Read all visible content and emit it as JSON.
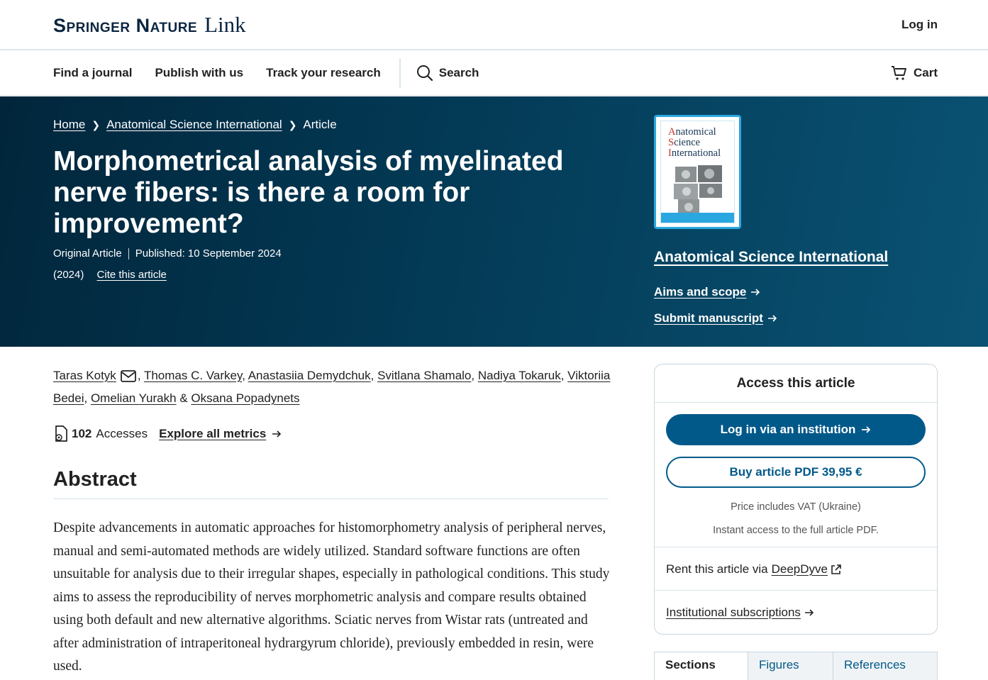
{
  "header": {
    "logo_main": "Springer Nature",
    "logo_link": "Link",
    "login": "Log in"
  },
  "nav": {
    "items": [
      "Find a journal",
      "Publish with us",
      "Track your research"
    ],
    "search": "Search",
    "cart": "Cart"
  },
  "hero": {
    "breadcrumb": [
      "Home",
      "Anatomical Science International",
      "Article"
    ],
    "title": "Morphometrical analysis of myelinated nerve fibers: is there a room for improvement?",
    "article_type": "Original Article",
    "published": "Published: 10 September 2024",
    "year": "(2024)",
    "cite": "Cite this article"
  },
  "journal": {
    "cover_title_lines": [
      [
        "A",
        "natomical"
      ],
      [
        "S",
        "cience"
      ],
      [
        "I",
        "nternational"
      ]
    ],
    "name": "Anatomical Science International",
    "aims": "Aims and scope",
    "submit": "Submit manuscript"
  },
  "authors": [
    "Taras Kotyk",
    "Thomas C. Varkey",
    "Anastasiia Demydchuk",
    "Svitlana Shamalo",
    "Nadiya Tokaruk",
    "Viktoriia Bedei",
    "Omelian Yurakh",
    "Oksana Popadynets"
  ],
  "metrics": {
    "count": "102",
    "label": "Accesses",
    "explore": "Explore all metrics"
  },
  "abstract": {
    "heading": "Abstract",
    "text": "Despite advancements in automatic approaches for histomorphometry analysis of peripheral nerves, manual and semi-automated methods are widely utilized. Standard software functions are often unsuitable for analysis due to their irregular shapes, especially in pathological conditions. This study aims to assess the reproducibility of nerves morphometric analysis and compare results obtained using both default and new alternative algorithms. Sciatic nerves from Wistar rats (untreated and after administration of intraperitoneal hydrargyrum chloride), previously embedded in resin, were used."
  },
  "access": {
    "title": "Access this article",
    "login_institution": "Log in via an institution",
    "buy": "Buy article PDF 39,95 €",
    "vat": "Price includes VAT (Ukraine)",
    "instant": "Instant access to the full article PDF.",
    "rent_prefix": "Rent this article via",
    "rent_link": "DeepDyve",
    "subscriptions": "Institutional subscriptions"
  },
  "tabs": [
    "Sections",
    "Figures",
    "References"
  ],
  "colors": {
    "brand_dark": "#01263b",
    "primary_button": "#01598a",
    "cover_accent": "#2aa7e0"
  }
}
